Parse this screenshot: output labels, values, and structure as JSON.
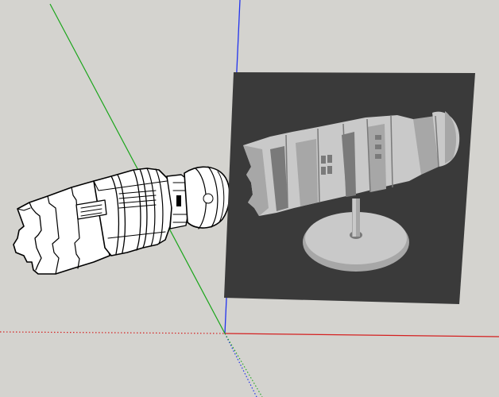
{
  "viewport": {
    "background": "#d4d3cf",
    "axes": {
      "green": "#1aa51a",
      "blue": "#2233ee",
      "red": "#d42020"
    },
    "line_color": "#000000",
    "model_face": "#ffffff",
    "texture_panel": {
      "background": "#3a3a3a",
      "model_light": "#c9c9c9",
      "model_mid": "#a7a7a7",
      "model_dark": "#7a7a7a"
    }
  },
  "objects": {
    "wireframe_model_icon": "spaceship-engine-sketch",
    "texture_image_icon": "spaceship-engine-render"
  }
}
